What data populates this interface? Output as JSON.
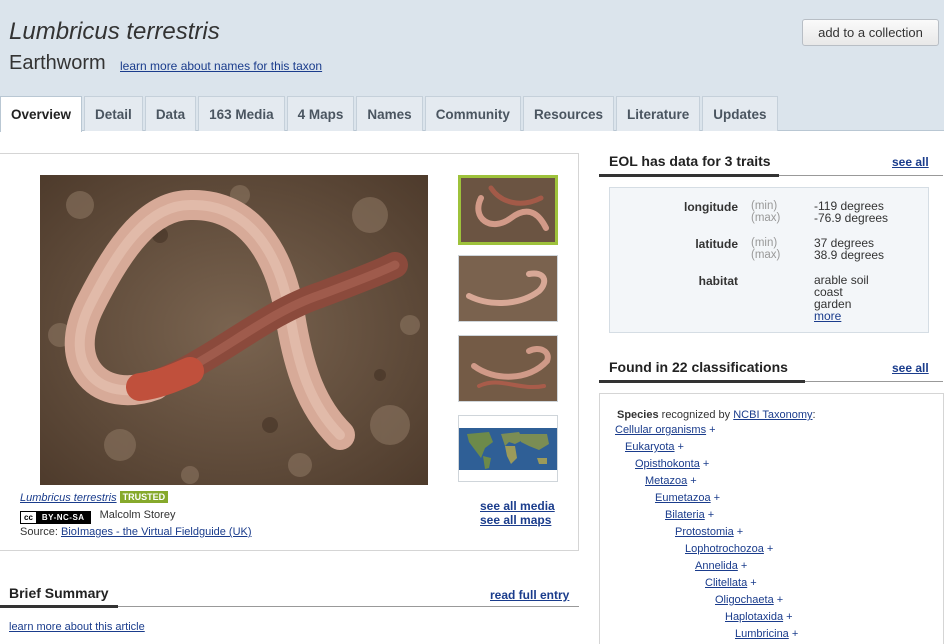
{
  "header": {
    "scientific_name": "Lumbricus terrestris",
    "common_name": "Earthworm",
    "names_link": "learn more about names for this taxon",
    "collection_button": "add to a collection"
  },
  "tabs": [
    {
      "label": "Overview",
      "active": true
    },
    {
      "label": "Detail"
    },
    {
      "label": "Data"
    },
    {
      "label": "163 Media"
    },
    {
      "label": "4 Maps"
    },
    {
      "label": "Names"
    },
    {
      "label": "Community"
    },
    {
      "label": "Resources"
    },
    {
      "label": "Literature"
    },
    {
      "label": "Updates"
    }
  ],
  "media": {
    "caption_name": "Lumbricus terrestris",
    "trusted_badge": "TRUSTED",
    "license_cc": "cc",
    "license_code": "BY-NC-SA",
    "author": "Malcolm Storey",
    "source_label": "Source:",
    "source_link": "BioImages - the Virtual Fieldguide (UK)",
    "see_all_media": "see all media",
    "see_all_maps": "see all maps"
  },
  "summary": {
    "heading": "Brief Summary",
    "read_full": "read full entry",
    "learn_more": "learn more about this article"
  },
  "traits": {
    "heading": "EOL has data for 3 traits",
    "see_all": "see all",
    "longitude": {
      "name": "longitude",
      "min_label": "(min)",
      "max_label": "(max)",
      "min": "-119 degrees",
      "max": "-76.9 degrees"
    },
    "latitude": {
      "name": "latitude",
      "min_label": "(min)",
      "max_label": "(max)",
      "min": "37 degrees",
      "max": "38.9 degrees"
    },
    "habitat": {
      "name": "habitat",
      "values": [
        "arable soil",
        "coast",
        "garden"
      ],
      "more": "more"
    }
  },
  "classifications": {
    "heading": "Found in 22 classifications",
    "see_all": "see all",
    "rank": "Species",
    "recognized_by": "recognized by",
    "provider": "NCBI Taxonomy",
    "colon": ":",
    "plus": "+",
    "lineage": [
      "Cellular organisms",
      "Eukaryota",
      "Opisthokonta",
      "Metazoa",
      "Eumetazoa",
      "Bilateria",
      "Protostomia",
      "Lophotrochozoa",
      "Annelida",
      "Clitellata",
      "Oligochaeta",
      "Haplotaxida",
      "Lumbricina"
    ]
  }
}
